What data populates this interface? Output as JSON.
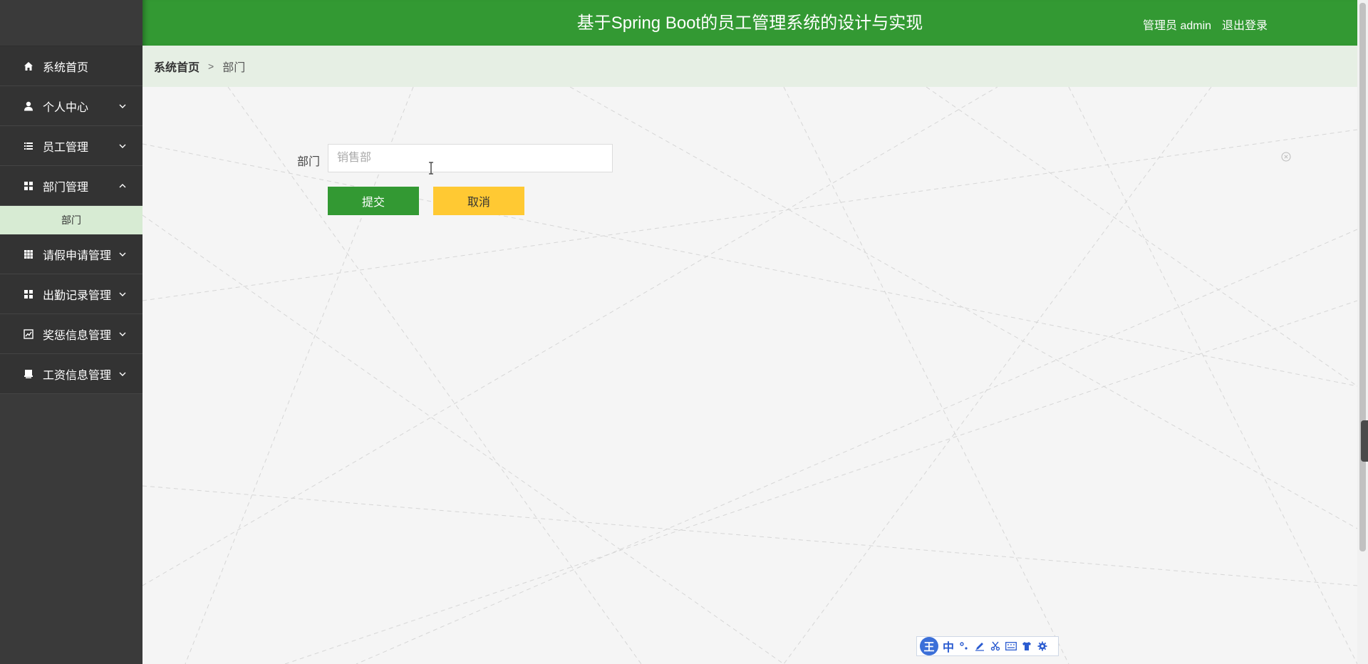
{
  "app": {
    "title": "基于Spring Boot的员工管理系统的设计与实现",
    "user_label": "管理员 admin",
    "logout_label": "退出登录"
  },
  "sidebar": {
    "items": [
      {
        "label": "系统首页",
        "icon": "home-icon",
        "has_arrow": false
      },
      {
        "label": "个人中心",
        "icon": "user-icon",
        "has_arrow": true,
        "expanded": false
      },
      {
        "label": "员工管理",
        "icon": "list-icon",
        "has_arrow": true,
        "expanded": false
      },
      {
        "label": "部门管理",
        "icon": "grid-icon",
        "has_arrow": true,
        "expanded": true
      },
      {
        "label": "请假申请管理",
        "icon": "table-icon",
        "has_arrow": true,
        "expanded": false
      },
      {
        "label": "出勤记录管理",
        "icon": "grid-icon",
        "has_arrow": true,
        "expanded": false
      },
      {
        "label": "奖惩信息管理",
        "icon": "chart-icon",
        "has_arrow": true,
        "expanded": false
      },
      {
        "label": "工资信息管理",
        "icon": "printer-icon",
        "has_arrow": true,
        "expanded": false
      }
    ],
    "subitems": {
      "department": [
        {
          "label": "部门",
          "active": true
        }
      ]
    }
  },
  "breadcrumb": {
    "home": "系统首页",
    "separator": ">",
    "current": "部门"
  },
  "form": {
    "department_label": "部门",
    "department_value": "",
    "department_placeholder": "销售部",
    "submit_label": "提交",
    "cancel_label": "取消"
  },
  "ime": {
    "logo": "王",
    "mode": "中",
    "icons": [
      "punctuation-icon",
      "pen-icon",
      "scissors-icon",
      "keyboard-icon",
      "shirt-icon",
      "settings-icon"
    ]
  },
  "colors": {
    "primary": "#339933",
    "warning": "#ffc933",
    "sidebar_bg": "#333333",
    "submenu_bg": "#d7ebd3",
    "breadcrumb_bg": "#e6efe4"
  }
}
